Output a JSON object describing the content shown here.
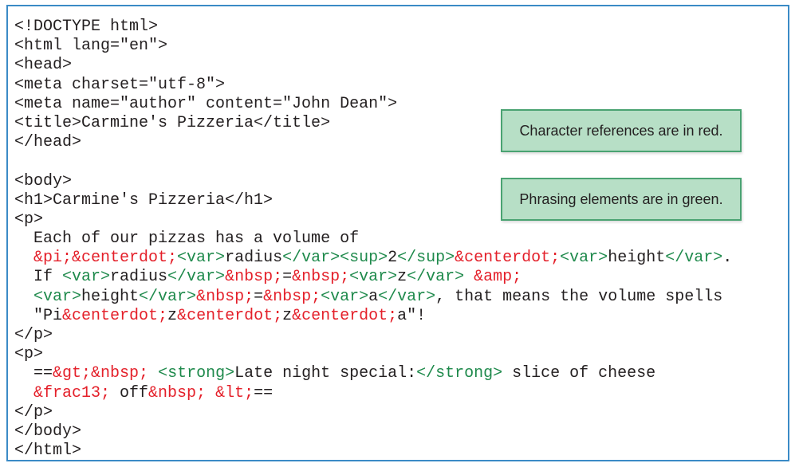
{
  "notes": {
    "char_refs": "Character references are in red.",
    "phrasing": "Phrasing elements are in green."
  },
  "code_lines": [
    [
      {
        "t": "text",
        "v": "<!DOCTYPE html>"
      }
    ],
    [
      {
        "t": "text",
        "v": "<html lang=\"en\">"
      }
    ],
    [
      {
        "t": "text",
        "v": "<head>"
      }
    ],
    [
      {
        "t": "text",
        "v": "<meta charset=\"utf-8\">"
      }
    ],
    [
      {
        "t": "text",
        "v": "<meta name=\"author\" content=\"John Dean\">"
      }
    ],
    [
      {
        "t": "text",
        "v": "<title>Carmine's Pizzeria</title>"
      }
    ],
    [
      {
        "t": "text",
        "v": "</head>"
      }
    ],
    [
      {
        "t": "text",
        "v": ""
      }
    ],
    [
      {
        "t": "text",
        "v": "<body>"
      }
    ],
    [
      {
        "t": "text",
        "v": "<h1>Carmine's Pizzeria</h1>"
      }
    ],
    [
      {
        "t": "text",
        "v": "<p>"
      }
    ],
    [
      {
        "t": "text",
        "v": "  Each of our pizzas has a volume of"
      }
    ],
    [
      {
        "t": "text",
        "v": "  "
      },
      {
        "t": "ref",
        "v": "&pi;&centerdot;"
      },
      {
        "t": "el",
        "v": "<var>"
      },
      {
        "t": "text",
        "v": "radius"
      },
      {
        "t": "el",
        "v": "</var><sup>"
      },
      {
        "t": "text",
        "v": "2"
      },
      {
        "t": "el",
        "v": "</sup>"
      },
      {
        "t": "ref",
        "v": "&centerdot;"
      },
      {
        "t": "el",
        "v": "<var>"
      },
      {
        "t": "text",
        "v": "height"
      },
      {
        "t": "el",
        "v": "</var>"
      },
      {
        "t": "text",
        "v": "."
      }
    ],
    [
      {
        "t": "text",
        "v": "  If "
      },
      {
        "t": "el",
        "v": "<var>"
      },
      {
        "t": "text",
        "v": "radius"
      },
      {
        "t": "el",
        "v": "</var>"
      },
      {
        "t": "ref",
        "v": "&nbsp;"
      },
      {
        "t": "text",
        "v": "="
      },
      {
        "t": "ref",
        "v": "&nbsp;"
      },
      {
        "t": "el",
        "v": "<var>"
      },
      {
        "t": "text",
        "v": "z"
      },
      {
        "t": "el",
        "v": "</var>"
      },
      {
        "t": "text",
        "v": " "
      },
      {
        "t": "ref",
        "v": "&amp;"
      }
    ],
    [
      {
        "t": "text",
        "v": "  "
      },
      {
        "t": "el",
        "v": "<var>"
      },
      {
        "t": "text",
        "v": "height"
      },
      {
        "t": "el",
        "v": "</var>"
      },
      {
        "t": "ref",
        "v": "&nbsp;"
      },
      {
        "t": "text",
        "v": "="
      },
      {
        "t": "ref",
        "v": "&nbsp;"
      },
      {
        "t": "el",
        "v": "<var>"
      },
      {
        "t": "text",
        "v": "a"
      },
      {
        "t": "el",
        "v": "</var>"
      },
      {
        "t": "text",
        "v": ", that means the volume spells"
      }
    ],
    [
      {
        "t": "text",
        "v": "  \"Pi"
      },
      {
        "t": "ref",
        "v": "&centerdot;"
      },
      {
        "t": "text",
        "v": "z"
      },
      {
        "t": "ref",
        "v": "&centerdot;"
      },
      {
        "t": "text",
        "v": "z"
      },
      {
        "t": "ref",
        "v": "&centerdot;"
      },
      {
        "t": "text",
        "v": "a\"!"
      }
    ],
    [
      {
        "t": "text",
        "v": "</p>"
      }
    ],
    [
      {
        "t": "text",
        "v": "<p>"
      }
    ],
    [
      {
        "t": "text",
        "v": "  =="
      },
      {
        "t": "ref",
        "v": "&gt;&nbsp;"
      },
      {
        "t": "text",
        "v": " "
      },
      {
        "t": "el",
        "v": "<strong>"
      },
      {
        "t": "text",
        "v": "Late night special:"
      },
      {
        "t": "el",
        "v": "</strong>"
      },
      {
        "t": "text",
        "v": " slice of cheese"
      }
    ],
    [
      {
        "t": "text",
        "v": "  "
      },
      {
        "t": "ref",
        "v": "&frac13;"
      },
      {
        "t": "text",
        "v": " off"
      },
      {
        "t": "ref",
        "v": "&nbsp;"
      },
      {
        "t": "text",
        "v": " "
      },
      {
        "t": "ref",
        "v": "&lt;"
      },
      {
        "t": "text",
        "v": "=="
      }
    ],
    [
      {
        "t": "text",
        "v": "</p>"
      }
    ],
    [
      {
        "t": "text",
        "v": "</body>"
      }
    ],
    [
      {
        "t": "text",
        "v": "</html>"
      }
    ]
  ]
}
